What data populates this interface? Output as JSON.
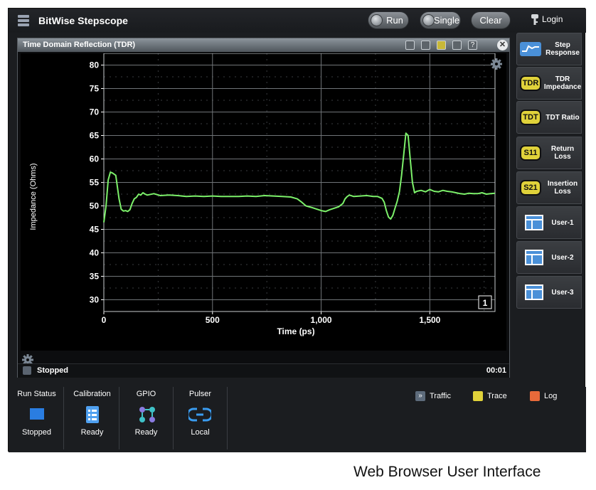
{
  "app": {
    "title": "BitWise Stepscope"
  },
  "toolbar": {
    "run_label": "Run",
    "single_label": "Single",
    "clear_label": "Clear",
    "login_label": "Login"
  },
  "window": {
    "title": "Time Domain Reflection (TDR)"
  },
  "status": {
    "text": "Stopped",
    "time": "00:01"
  },
  "sidebar": {
    "items": [
      {
        "icon": "step-response-icon",
        "label": "Step Response"
      },
      {
        "icon": "TDR",
        "label": "TDR Impedance"
      },
      {
        "icon": "TDT",
        "label": "TDT Ratio"
      },
      {
        "icon": "S11",
        "label": "Return Loss"
      },
      {
        "icon": "S21",
        "label": "Insertion Loss"
      },
      {
        "icon": "user-layout-icon",
        "label": "User-1"
      },
      {
        "icon": "user-layout-icon",
        "label": "User-2"
      },
      {
        "icon": "user-layout-icon",
        "label": "User-3"
      }
    ]
  },
  "bottom": {
    "tiles": [
      {
        "title": "Run Status",
        "value": "Stopped",
        "icon": "stop-square-icon"
      },
      {
        "title": "Calibration",
        "value": "Ready",
        "icon": "checklist-icon"
      },
      {
        "title": "GPIO",
        "value": "Ready",
        "icon": "gpio-icon"
      },
      {
        "title": "Pulser",
        "value": "Local",
        "icon": "link-icon"
      }
    ],
    "links": [
      {
        "label": "Traffic",
        "icon": "traffic-icon"
      },
      {
        "label": "Trace",
        "icon": "trace-icon"
      },
      {
        "label": "Log",
        "icon": "log-icon"
      }
    ]
  },
  "caption": "Web Browser User Interface",
  "colors": {
    "trace": "#7cf06a",
    "badge": "#e0d23a",
    "user_icon": "#4a90d8"
  },
  "chart_data": {
    "type": "line",
    "xlabel": "Time (ps)",
    "ylabel": "Impedance (Ohms)",
    "xlim": [
      0,
      1800
    ],
    "ylim": [
      27.5,
      82.5
    ],
    "xticks": [
      0,
      500,
      1000,
      1500
    ],
    "xtick_labels": [
      "0",
      "500",
      "1,000",
      "1,500"
    ],
    "yticks": [
      30,
      35,
      40,
      45,
      50,
      55,
      60,
      65,
      70,
      75,
      80
    ],
    "grid": true,
    "marker_label": "1",
    "series": [
      {
        "x": [
          0,
          10,
          20,
          30,
          40,
          55,
          70,
          80,
          90,
          100,
          110,
          120,
          130,
          140,
          150,
          160,
          170,
          180,
          190,
          200,
          230,
          260,
          300,
          340,
          380,
          420,
          460,
          500,
          540,
          580,
          620,
          660,
          700,
          740,
          780,
          820,
          860,
          890,
          910,
          930,
          960,
          980,
          1000,
          1020,
          1040,
          1060,
          1080,
          1100,
          1110,
          1120,
          1130,
          1150,
          1180,
          1210,
          1240,
          1260,
          1280,
          1290,
          1300,
          1310,
          1320,
          1330,
          1340,
          1350,
          1360,
          1370,
          1380,
          1390,
          1400,
          1410,
          1420,
          1430,
          1440,
          1460,
          1480,
          1500,
          1520,
          1540,
          1560,
          1580,
          1600,
          1620,
          1640,
          1660,
          1680,
          1700,
          1720,
          1740,
          1760,
          1780,
          1800
        ],
        "y": [
          46.5,
          50,
          55.5,
          57.2,
          57.0,
          56.5,
          51.5,
          49.3,
          48.9,
          49.0,
          48.8,
          49.2,
          50.5,
          51.5,
          51.8,
          52.5,
          52.3,
          52.8,
          52.5,
          52.3,
          52.6,
          52.2,
          52.3,
          52.2,
          52.0,
          52.1,
          52.0,
          52.1,
          52.0,
          52.0,
          52.0,
          52.1,
          52.0,
          52.2,
          52.1,
          52.0,
          51.9,
          51.5,
          50.8,
          50.0,
          49.6,
          49.3,
          49.0,
          48.8,
          49.2,
          49.5,
          49.8,
          50.5,
          51.5,
          52.0,
          52.3,
          52.0,
          52.1,
          52.2,
          52.0,
          52.0,
          51.6,
          50.8,
          49.0,
          47.6,
          47.2,
          48.0,
          49.5,
          51.0,
          53.0,
          56.5,
          61.0,
          65.5,
          65.0,
          60.0,
          55.0,
          52.8,
          53.1,
          53.3,
          53.0,
          53.5,
          53.1,
          53.0,
          53.3,
          53.1,
          53.0,
          52.8,
          52.6,
          52.5,
          52.7,
          52.6,
          52.6,
          52.8,
          52.5,
          52.6,
          52.7
        ]
      }
    ]
  }
}
